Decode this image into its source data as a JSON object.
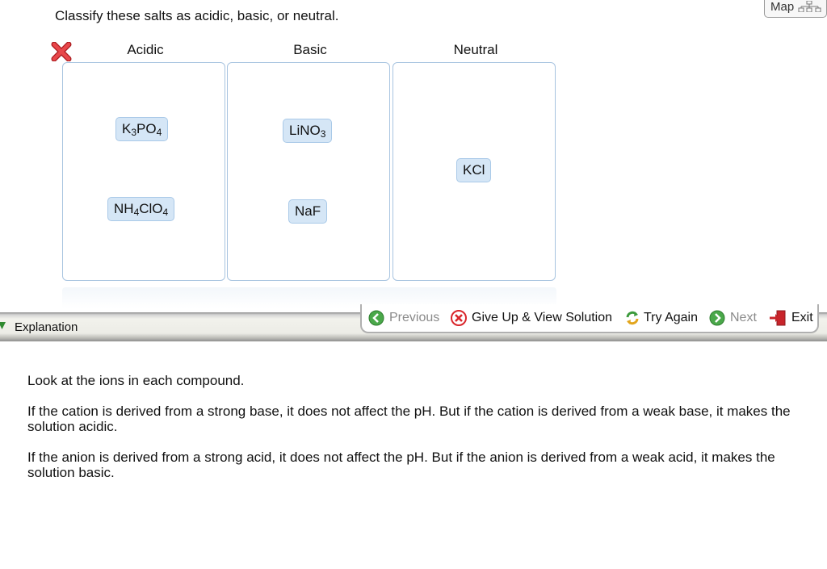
{
  "question": "Classify these salts as acidic, basic, or neutral.",
  "map_button": {
    "label": "Map",
    "icon": "map-hierarchy-icon"
  },
  "columns": [
    {
      "heading": "Acidic",
      "chips": [
        {
          "main": "K",
          "sub1": "3",
          "mid": "PO",
          "sub2": "4"
        },
        {
          "main": "NH",
          "sub1": "4",
          "mid": "ClO",
          "sub2": "4"
        }
      ]
    },
    {
      "heading": "Basic",
      "chips": [
        {
          "main": "LiNO",
          "sub1": "3"
        },
        {
          "main": "NaF"
        }
      ]
    },
    {
      "heading": "Neutral",
      "chips": [
        {
          "main": "KCl"
        }
      ]
    }
  ],
  "feedback_icon": "wrong-answer-x-icon",
  "explanation_tab": {
    "label": "Explanation"
  },
  "toolbar": {
    "previous": "Previous",
    "give_up": "Give Up & View Solution",
    "try_again": "Try Again",
    "next": "Next",
    "exit": "Exit"
  },
  "explanation": [
    "Look at the ions in each compound.",
    "If the cation is derived from a strong base, it does not affect the pH. But if the cation is derived from a weak base, it makes the solution acidic.",
    "If the anion is derived from a strong acid, it does not affect the pH. But if the anion is derived from a weak acid, it makes the solution basic."
  ],
  "colors": {
    "bin_border": "#a8c4e0",
    "chip_bg": "#d5e6f6",
    "wrong_red": "#d9262b",
    "nav_green": "#3c9a3c"
  }
}
